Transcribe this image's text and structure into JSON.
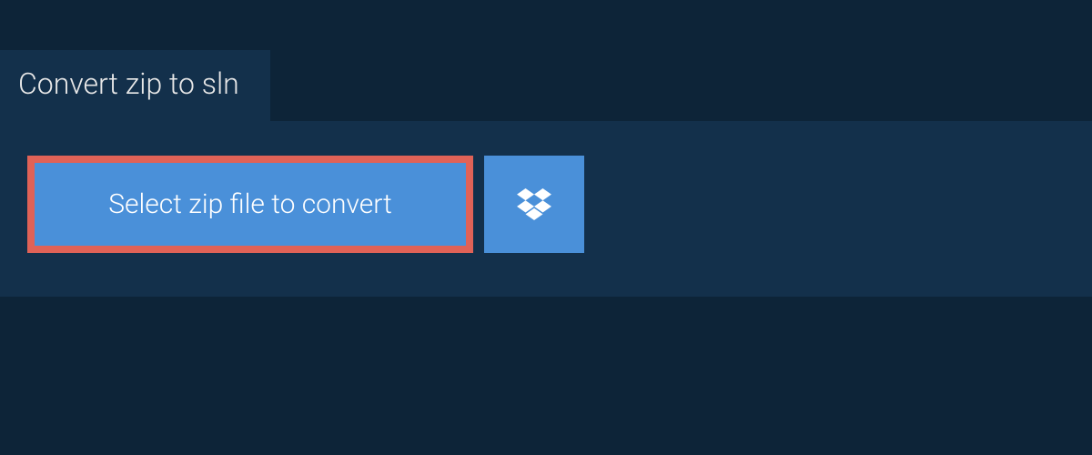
{
  "tab": {
    "title": "Convert zip to sln"
  },
  "panel": {
    "select_button_label": "Select zip file to convert"
  },
  "colors": {
    "background": "#0d2438",
    "panel": "#13304b",
    "button": "#4a90d9",
    "highlight_border": "#e06257",
    "text_light": "#e8e8e8",
    "text_white": "#ffffff"
  }
}
